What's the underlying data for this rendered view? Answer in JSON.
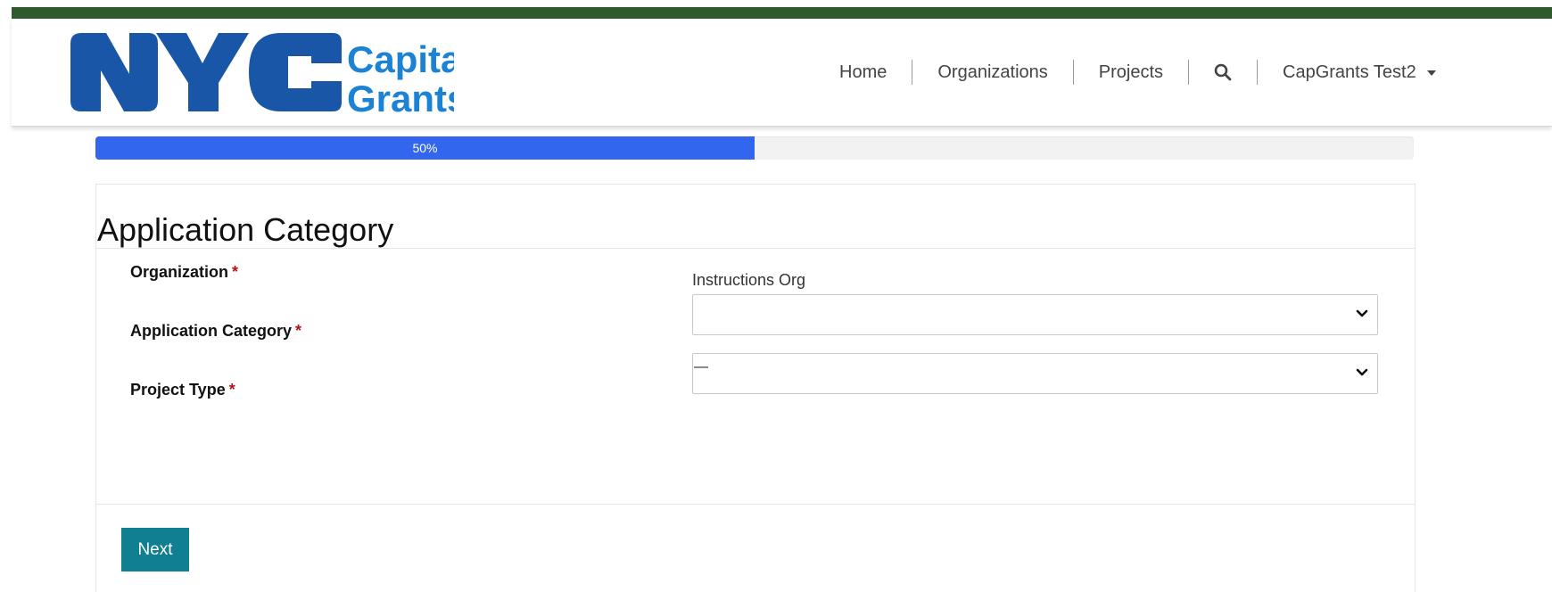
{
  "header": {
    "logo": {
      "mark_text": "NYC",
      "line1": "Capital",
      "line2": "Grants",
      "color": "#1a56a8",
      "accent": "#1c82d4"
    },
    "nav": [
      {
        "label": "Home"
      },
      {
        "label": "Organizations"
      },
      {
        "label": "Projects"
      },
      {
        "icon": "search-icon"
      },
      {
        "label": "CapGrants Test2",
        "dropdown": true
      }
    ]
  },
  "progress": {
    "value": 50,
    "label": "50%",
    "color": "#3366ee"
  },
  "form": {
    "title": "Application Category",
    "fields": [
      {
        "label": "Organization",
        "required_mark": "*",
        "value": "Instructions Org"
      },
      {
        "label": "Application Category",
        "required_mark": "*",
        "selected": ""
      },
      {
        "label": "Project Type",
        "required_mark": "*",
        "selected": "—"
      }
    ],
    "next_label": "Next",
    "button_color": "#0f7f91"
  }
}
